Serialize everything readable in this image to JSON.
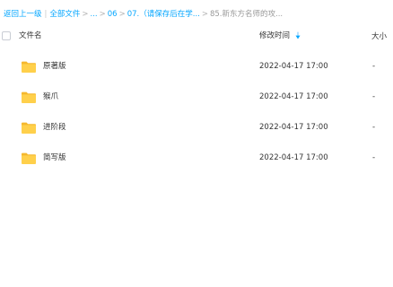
{
  "breadcrumb": {
    "back": "返回上一级",
    "all_files": "全部文件",
    "ellipsis": "...",
    "folder_06": "06",
    "folder_07": "07.（请保存后在学...",
    "current": "85.新东方名师的攻...",
    "separator": ">",
    "divider": "|"
  },
  "table": {
    "col_name": "文件名",
    "col_time": "修改时间",
    "col_size": "大小",
    "rows": [
      {
        "name": "原著版",
        "time": "2022-04-17 17:00",
        "size": "-"
      },
      {
        "name": "猴爪",
        "time": "2022-04-17 17:00",
        "size": "-"
      },
      {
        "name": "进阶段",
        "time": "2022-04-17 17:00",
        "size": "-"
      },
      {
        "name": "简写版",
        "time": "2022-04-17 17:00",
        "size": "-"
      }
    ]
  },
  "colors": {
    "link": "#06a7ff",
    "folder": "#ffd04b",
    "folder_dark": "#f5b82e"
  },
  "icons": {
    "row_icon": "folder-icon",
    "sort_icon": "sort-icon"
  }
}
